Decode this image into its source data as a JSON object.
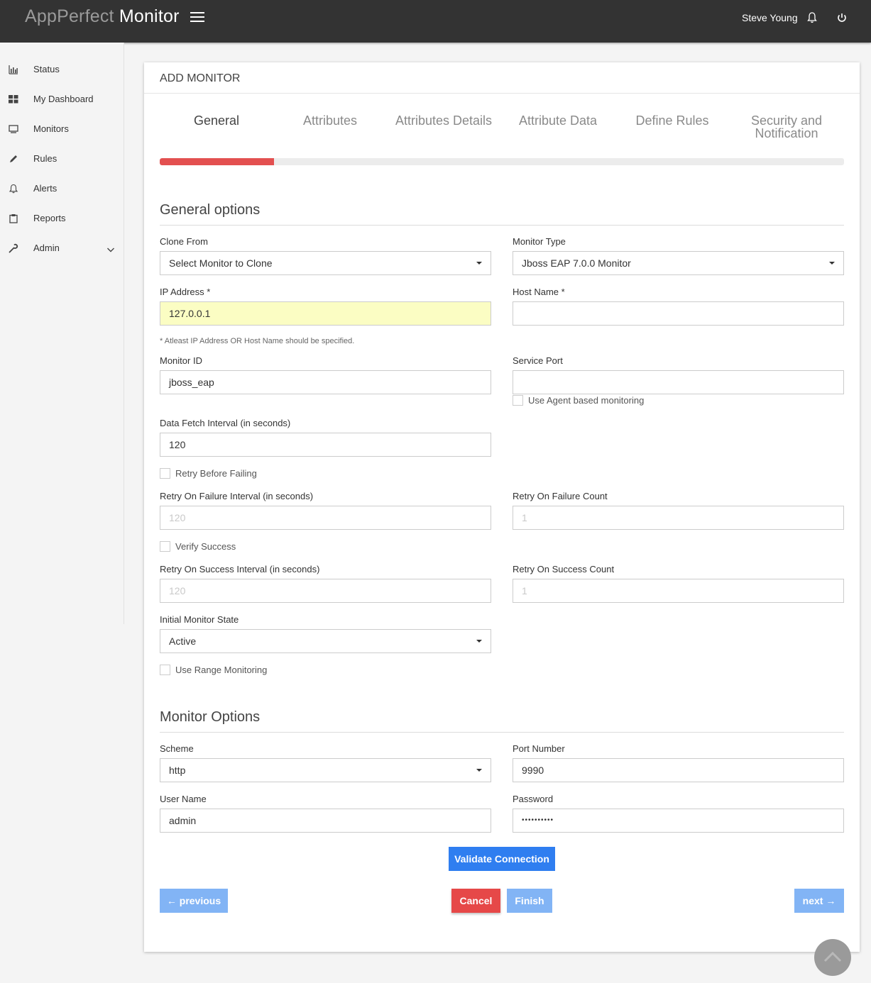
{
  "app": {
    "title_part1": "AppPerfect ",
    "title_part2": "Monitor",
    "user_name": "Steve Young"
  },
  "sidebar": {
    "items": [
      {
        "label": "Status",
        "icon": "bar-chart-icon"
      },
      {
        "label": "My Dashboard",
        "icon": "dashboard-grid-icon"
      },
      {
        "label": "Monitors",
        "icon": "monitor-icon"
      },
      {
        "label": "Rules",
        "icon": "pencil-icon"
      },
      {
        "label": "Alerts",
        "icon": "bell-icon"
      },
      {
        "label": "Reports",
        "icon": "clipboard-icon"
      },
      {
        "label": "Admin",
        "icon": "wrench-icon"
      }
    ]
  },
  "card": {
    "title": "ADD MONITOR"
  },
  "wizard": {
    "steps": [
      "General",
      "Attributes",
      "Attributes Details",
      "Attribute Data",
      "Define Rules",
      "Security and Notification"
    ],
    "active_step": 0,
    "progress_fraction": 0.1667,
    "progress_color": "#e35050"
  },
  "general": {
    "section_title": "General options",
    "clone_from_label": "Clone From",
    "clone_from_value": "Select Monitor to Clone",
    "monitor_type_label": "Monitor Type",
    "monitor_type_value": "Jboss EAP 7.0.0 Monitor",
    "ip_label": "IP Address *",
    "ip_value": "127.0.0.1",
    "host_label": "Host Name *",
    "host_value": "",
    "ip_hint": "* Atleast IP Address OR Host Name should be specified.",
    "monitor_id_label": "Monitor ID",
    "monitor_id_value": "jboss_eap",
    "service_port_label": "Service Port",
    "service_port_value": "",
    "agent_label": "Use Agent based monitoring",
    "fetch_label": "Data Fetch Interval (in seconds)",
    "fetch_value": "120",
    "retry_before_label": "Retry Before Failing",
    "retry_fail_interval_label": "Retry On Failure Interval (in seconds)",
    "retry_fail_interval_value": "120",
    "retry_fail_count_label": "Retry On Failure Count",
    "retry_fail_count_value": "1",
    "verify_label": "Verify Success",
    "retry_success_interval_label": "Retry On Success Interval (in seconds)",
    "retry_success_interval_value": "120",
    "retry_success_count_label": "Retry On Success Count",
    "retry_success_count_value": "1",
    "initial_state_label": "Initial Monitor State",
    "initial_state_value": "Active",
    "range_label": "Use Range Monitoring"
  },
  "monitor_options": {
    "section_title": "Monitor Options",
    "scheme_label": "Scheme",
    "scheme_value": "http",
    "port_label": "Port Number",
    "port_value": "9990",
    "user_label": "User Name",
    "user_value": "admin",
    "password_label": "Password",
    "password_value": "••••••••••"
  },
  "buttons": {
    "validate": "Validate Connection",
    "previous": "← previous",
    "cancel": "Cancel",
    "finish": "Finish",
    "next": "next →"
  }
}
